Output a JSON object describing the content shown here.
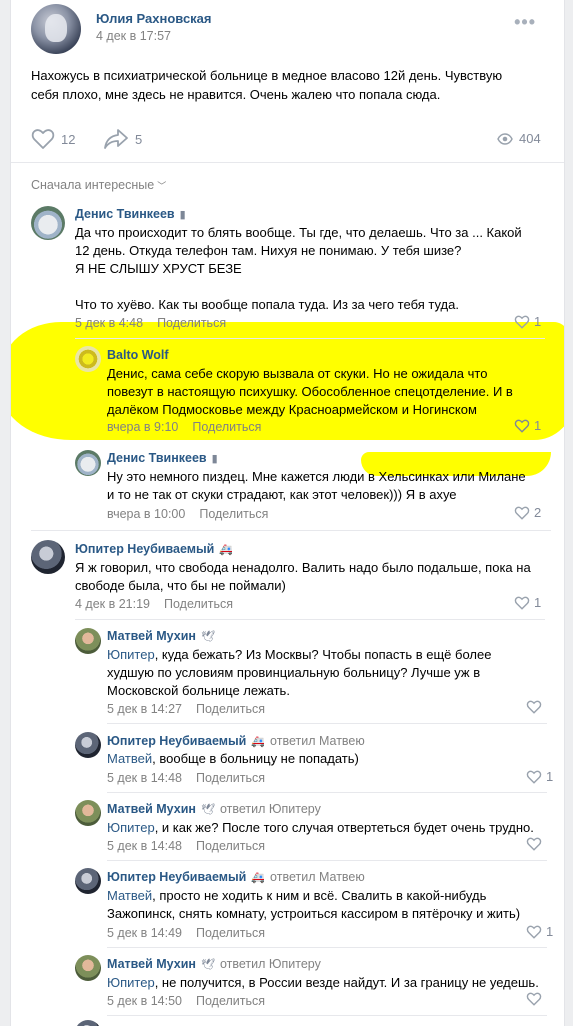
{
  "post": {
    "author": "Юлия Рахновская",
    "date": "4 дек в 17:57",
    "text_line1": "Нахожусь в психиатрической больнице в медное власово 12й день. Чувствую",
    "text_line2": "себя плохо, мне здесь не нравится. Очень жалею что попала сюда.",
    "likes": "12",
    "shares": "5",
    "views": "404"
  },
  "sort_label": "Сначала интересные",
  "comments": [
    {
      "author": "Денис Твинкеев",
      "lines": [
        "Да что происходит то блять вообще. Ты где, что делаешь. Что за ... Какой",
        "12 день. Откуда телефон там. Нихуя не понимаю. У тебя шизе?",
        "Я НЕ СЛЫШУ ХРУСТ БЕЗЕ",
        "",
        "Что то хуёво. Как ты вообще попала туда. Из за чего тебя туда."
      ],
      "date": "5 дек в 4:48",
      "share": "Поделиться",
      "likes": "1"
    },
    {
      "author": "Balto Wolf",
      "lines": [
        "Денис, сама себе скорую вызвала от скуки. Но не ожидала что",
        "повезут в настоящую психушку. Обособленное спецотделение. И в",
        "далёком Подмосковье между Красноармейском и Ногинском"
      ],
      "date": "вчера в 9:10",
      "share": "Поделиться",
      "likes": "1"
    },
    {
      "author": "Денис Твинкеев",
      "lines": [
        "Ну это немного пиздец. Мне кажется люди в Хельсинках или Милане",
        "и то не так от скуки страдают, как этот человек))) Я в ахуе"
      ],
      "date": "вчера в 10:00",
      "share": "Поделиться",
      "likes": "2"
    },
    {
      "author": "Юпитер Неубиваемый",
      "lines": [
        "Я ж говорил, что свобода ненадолго. Валить надо было подальше, пока на",
        "свободе была, что бы не поймали)"
      ],
      "date": "4 дек в 21:19",
      "share": "Поделиться",
      "likes": "1"
    },
    {
      "author": "Матвей Мухин",
      "reply_to": "",
      "mention": "Юпитер",
      "lines": [
        ", куда бежать? Из Москвы? Чтобы попасть в ещё более",
        "худшую по условиям провинциальную больницу? Лучше уж в",
        "Московской больнице лежать."
      ],
      "date": "5 дек в 14:27",
      "share": "Поделиться",
      "likes": ""
    },
    {
      "author": "Юпитер Неубиваемый",
      "reply_to": "ответил Матвею",
      "mention": "Матвей",
      "lines": [
        ", вообще в больницу не попадать)"
      ],
      "date": "5 дек в 14:48",
      "share": "Поделиться",
      "likes": "1"
    },
    {
      "author": "Матвей Мухин",
      "reply_to": "ответил Юпитеру",
      "mention": "Юпитер",
      "lines": [
        ", и как же? После того случая отвертеться будет очень трудно."
      ],
      "date": "5 дек в 14:48",
      "share": "Поделиться",
      "likes": ""
    },
    {
      "author": "Юпитер Неубиваемый",
      "reply_to": "ответил Матвею",
      "mention": "Матвей",
      "lines": [
        ", просто не ходить к ним и всё. Свалить в какой-нибудь",
        "Зажопинск, снять комнату, устроиться кассиром в пятёрочку и жить)"
      ],
      "date": "5 дек в 14:49",
      "share": "Поделиться",
      "likes": "1"
    },
    {
      "author": "Матвей Мухин",
      "reply_to": "ответил Юпитеру",
      "mention": "Юпитер",
      "lines": [
        ", не получится, в России везде найдут. И за границу не уедешь."
      ],
      "date": "5 дек в 14:50",
      "share": "Поделиться",
      "likes": ""
    }
  ],
  "icons": {
    "like": "heart-icon",
    "share": "share-arrow-icon",
    "views": "eye-icon",
    "menu": "more-dots-icon"
  },
  "colors": {
    "link": "#2a5885",
    "muted": "#828282",
    "highlight": "#ffff00"
  }
}
